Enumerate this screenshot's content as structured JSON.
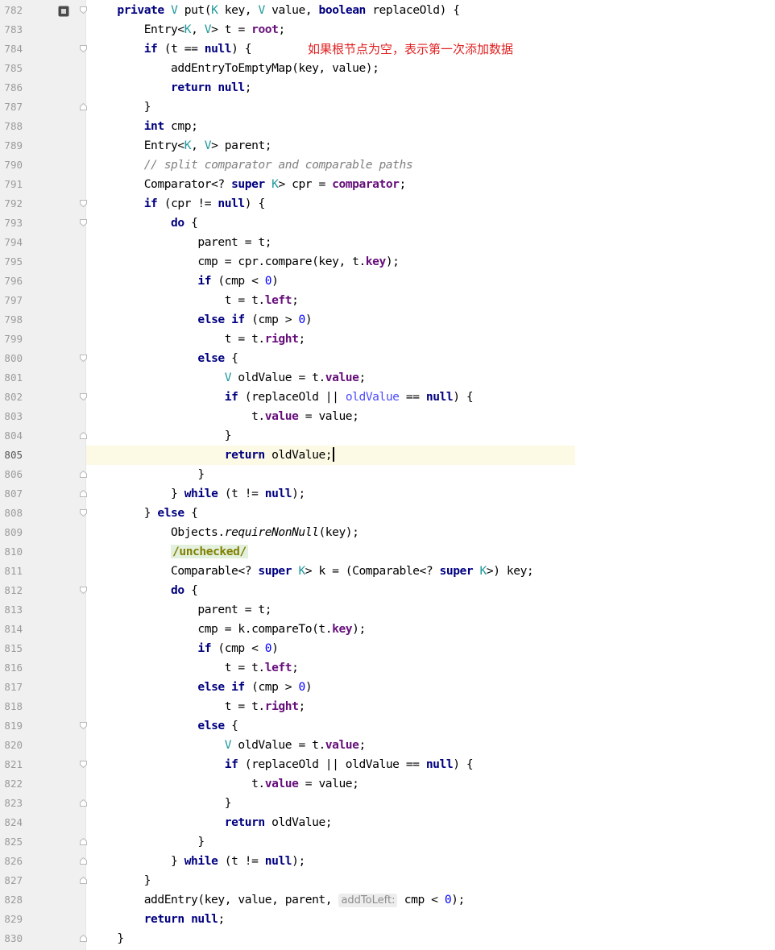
{
  "editor": {
    "annotation_text": "如果根节点为空，表示第一次添加数据",
    "current_line": "805",
    "lines": [
      {
        "number": "782",
        "marker": "breakpoint-collapse",
        "code": "    private V put(K key, V value, boolean replaceOld) {"
      },
      {
        "number": "783",
        "code": "        Entry<K, V> t = root;"
      },
      {
        "number": "784",
        "marker": "fold-start",
        "code": "        if (t == null) {"
      },
      {
        "number": "785",
        "code": "            addEntryToEmptyMap(key, value);"
      },
      {
        "number": "786",
        "code": "            return null;"
      },
      {
        "number": "787",
        "marker": "fold-end",
        "code": "        }"
      },
      {
        "number": "788",
        "code": "        int cmp;"
      },
      {
        "number": "789",
        "code": "        Entry<K, V> parent;"
      },
      {
        "number": "790",
        "code": "        // split comparator and comparable paths"
      },
      {
        "number": "791",
        "code": "        Comparator<? super K> cpr = comparator;"
      },
      {
        "number": "792",
        "marker": "fold-start",
        "code": "        if (cpr != null) {"
      },
      {
        "number": "793",
        "marker": "fold-start",
        "code": "            do {"
      },
      {
        "number": "794",
        "code": "                parent = t;"
      },
      {
        "number": "795",
        "code": "                cmp = cpr.compare(key, t.key);"
      },
      {
        "number": "796",
        "code": "                if (cmp < 0)"
      },
      {
        "number": "797",
        "code": "                    t = t.left;"
      },
      {
        "number": "798",
        "code": "                else if (cmp > 0)"
      },
      {
        "number": "799",
        "code": "                    t = t.right;"
      },
      {
        "number": "800",
        "marker": "fold-start",
        "code": "                else {"
      },
      {
        "number": "801",
        "code": "                    V oldValue = t.value;"
      },
      {
        "number": "802",
        "marker": "fold-start",
        "code": "                    if (replaceOld || oldValue == null) {"
      },
      {
        "number": "803",
        "code": "                        t.value = value;"
      },
      {
        "number": "804",
        "marker": "fold-end",
        "code": "                    }"
      },
      {
        "number": "805",
        "code": "                    return oldValue;"
      },
      {
        "number": "806",
        "marker": "fold-end",
        "code": "                }"
      },
      {
        "number": "807",
        "marker": "fold-end",
        "code": "            } while (t != null);"
      },
      {
        "number": "808",
        "marker": "fold-start",
        "code": "        } else {"
      },
      {
        "number": "809",
        "code": "            Objects.requireNonNull(key);"
      },
      {
        "number": "810",
        "code": "            /unchecked/"
      },
      {
        "number": "811",
        "code": "            Comparable<? super K> k = (Comparable<? super K>) key;"
      },
      {
        "number": "812",
        "marker": "fold-start",
        "code": "            do {"
      },
      {
        "number": "813",
        "code": "                parent = t;"
      },
      {
        "number": "814",
        "code": "                cmp = k.compareTo(t.key);"
      },
      {
        "number": "815",
        "code": "                if (cmp < 0)"
      },
      {
        "number": "816",
        "code": "                    t = t.left;"
      },
      {
        "number": "817",
        "code": "                else if (cmp > 0)"
      },
      {
        "number": "818",
        "code": "                    t = t.right;"
      },
      {
        "number": "819",
        "marker": "fold-start",
        "code": "                else {"
      },
      {
        "number": "820",
        "code": "                    V oldValue = t.value;"
      },
      {
        "number": "821",
        "marker": "fold-start",
        "code": "                    if (replaceOld || oldValue == null) {"
      },
      {
        "number": "822",
        "code": "                        t.value = value;"
      },
      {
        "number": "823",
        "marker": "fold-end",
        "code": "                    }"
      },
      {
        "number": "824",
        "code": "                    return oldValue;"
      },
      {
        "number": "825",
        "marker": "fold-end",
        "code": "                }"
      },
      {
        "number": "826",
        "marker": "fold-end",
        "code": "            } while (t != null);"
      },
      {
        "number": "827",
        "marker": "fold-end",
        "code": "        }"
      },
      {
        "number": "828",
        "code": "        addEntry(key, value, parent, addToLeft: cmp < 0);"
      },
      {
        "number": "829",
        "code": "        return null;"
      },
      {
        "number": "830",
        "marker": "fold-end",
        "code": "    }"
      }
    ]
  },
  "colors": {
    "keyword": "#000080",
    "type_param": "#20999d",
    "field": "#660e7a",
    "number": "#0000ff",
    "comment": "#808080",
    "annotation_note": "#e01f1f",
    "current_line_bg": "#fcfae4",
    "gutter_bg": "#f0f0f0"
  },
  "icons": {
    "breakpoint": "breakpoint-icon",
    "fold_start": "fold-start-icon",
    "fold_end": "fold-end-icon"
  }
}
